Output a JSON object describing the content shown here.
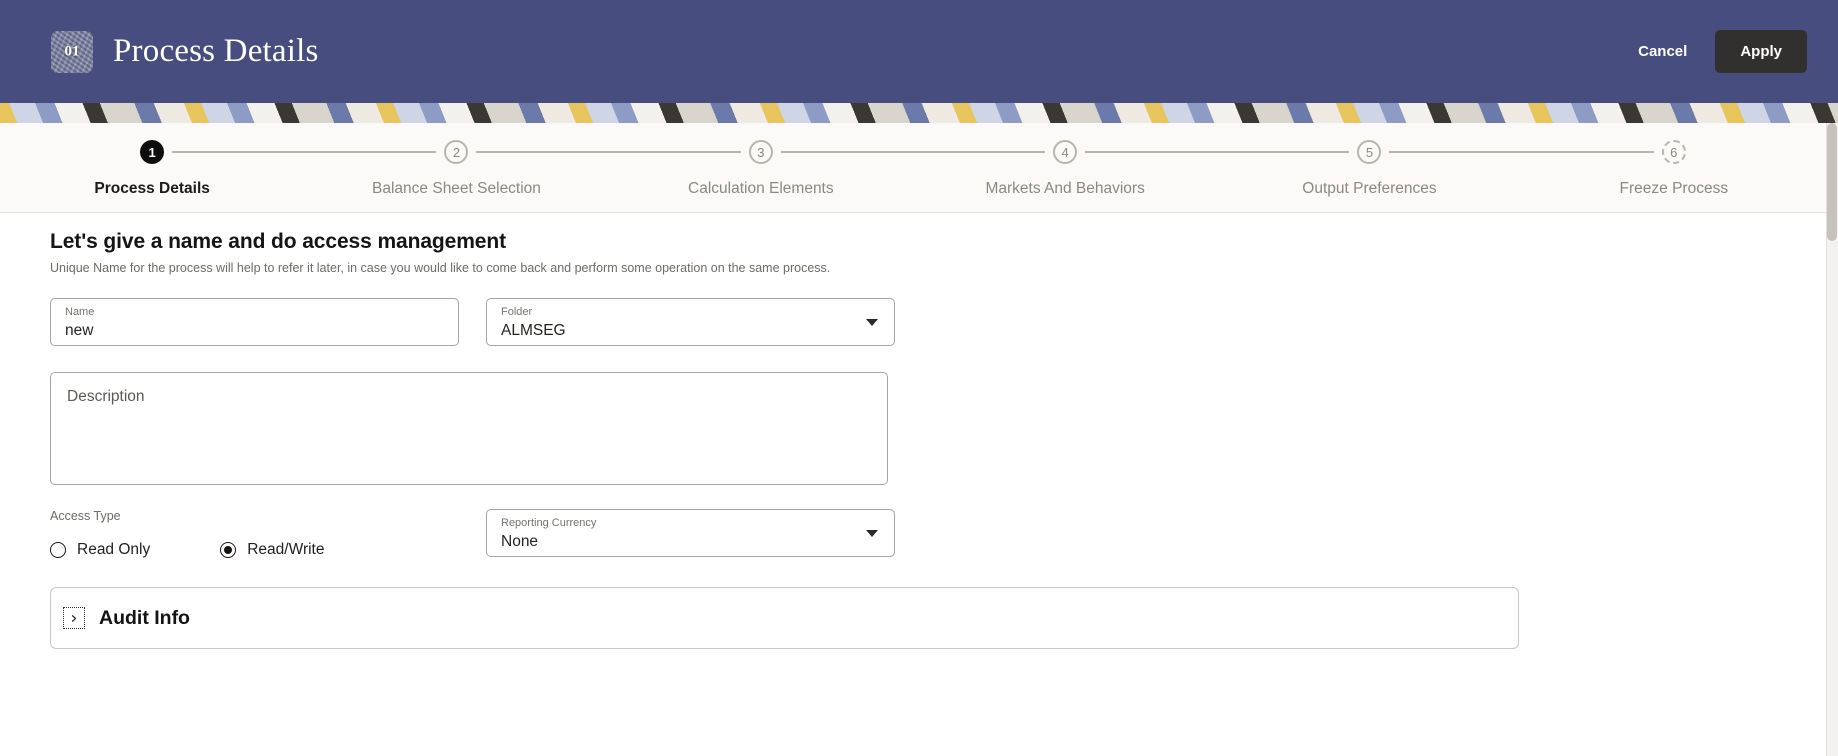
{
  "header": {
    "badge_number": "01",
    "title": "Process Details",
    "cancel_label": "Cancel",
    "apply_label": "Apply",
    "background_color": "#474d7e",
    "apply_color": "#32302e"
  },
  "stepper": {
    "steps": [
      {
        "number": "1",
        "label": "Process Details",
        "state": "active"
      },
      {
        "number": "2",
        "label": "Balance Sheet Selection",
        "state": "pending"
      },
      {
        "number": "3",
        "label": "Calculation Elements",
        "state": "pending"
      },
      {
        "number": "4",
        "label": "Markets And Behaviors",
        "state": "pending"
      },
      {
        "number": "5",
        "label": "Output Preferences",
        "state": "pending"
      },
      {
        "number": "6",
        "label": "Freeze Process",
        "state": "dashed"
      }
    ]
  },
  "main": {
    "heading": "Let's give a name and do access management",
    "subheading": "Unique Name for the process will help to refer it later, in case you would like to come back and perform some operation on the same process.",
    "name_field": {
      "label": "Name",
      "value": "new"
    },
    "folder_field": {
      "label": "Folder",
      "value": "ALMSEG"
    },
    "description_field": {
      "placeholder": "Description",
      "value": ""
    },
    "access_type": {
      "label": "Access Type",
      "options": [
        {
          "label": "Read Only",
          "selected": false
        },
        {
          "label": "Read/Write",
          "selected": true
        }
      ]
    },
    "reporting_currency": {
      "label": "Reporting Currency",
      "value": "None"
    },
    "audit_info": {
      "title": "Audit Info",
      "expanded": false,
      "toggle_icon": "chevron-right-icon"
    }
  }
}
